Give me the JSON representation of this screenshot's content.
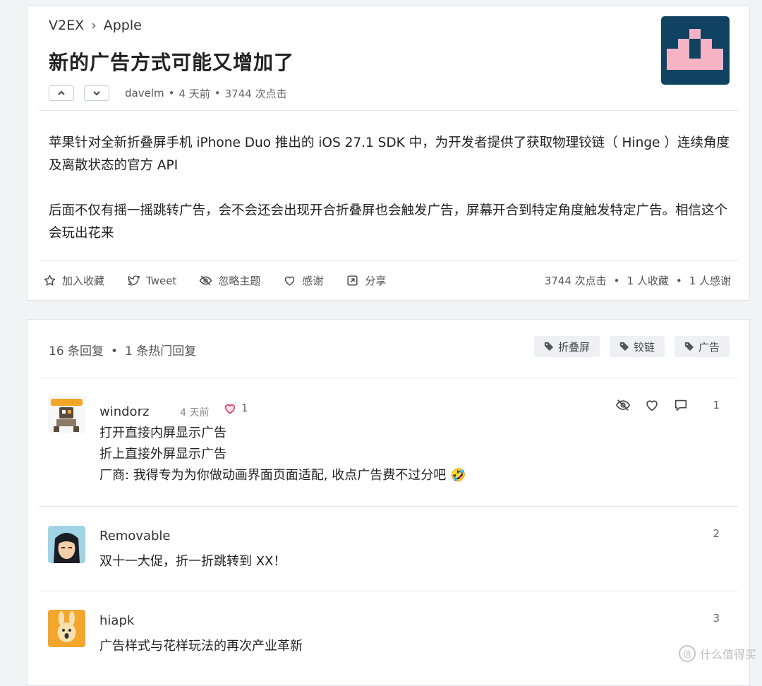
{
  "topic": {
    "breadcrumb": {
      "site": "V2EX",
      "separator": "›",
      "node": "Apple"
    },
    "title": "新的广告方式可能又增加了",
    "author": "davelm",
    "time": "4 天前",
    "clicks": "3744 次点击",
    "content": [
      "苹果针对全新折叠屏手机 iPhone Duo 推出的 iOS 27.1 SDK 中，为开发者提供了获取物理铰链（ Hinge ）连续角度及离散状态的官方 API",
      "后面不仅有摇一摇跳转广告，会不会还会出现开合折叠屏也会触发广告，屏幕开合到特定角度触发特定广告。相信这个会玩出花来"
    ],
    "actions": {
      "favorite": "加入收藏",
      "tweet": "Tweet",
      "ignore": "忽略主题",
      "thanks": "感谢",
      "share": "分享"
    },
    "stats": {
      "clicks": "3744 次点击",
      "favorites": "1 人收藏",
      "thanks": "1 人感谢"
    }
  },
  "replies": {
    "count_text": "16 条回复",
    "hot_text": "1 条热门回复",
    "tags": [
      "折叠屏",
      "铰链",
      "广告"
    ],
    "items": [
      {
        "username": "windorz",
        "time": "4 天前",
        "likes": "1",
        "lines": [
          "打开直接内屏显示广告",
          "折上直接外屏显示广告",
          "厂商: 我得专为为你做动画界面页面适配, 收点广告费不过分吧 🤣"
        ],
        "number": "1"
      },
      {
        "username": "Removable",
        "lines": [
          "双十一大促，折一折跳转到 XX！"
        ],
        "number": "2"
      },
      {
        "username": "hiapk",
        "lines": [
          "广告样式与花样玩法的再次产业革新"
        ],
        "number": "3"
      }
    ]
  },
  "watermark": "什么值得买",
  "colors": {
    "node_bg": "#0f4361",
    "node_pink": "#f5b3c4",
    "heart": "#e0245e"
  }
}
